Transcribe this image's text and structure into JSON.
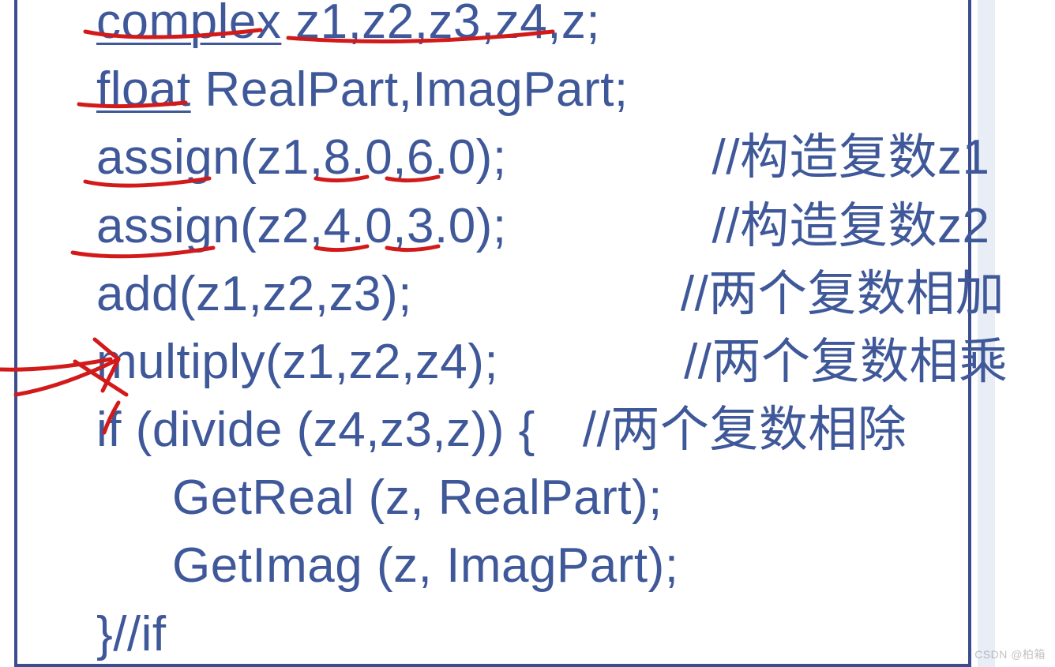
{
  "code": {
    "line1": {
      "kw": "complex",
      "rest": " z1,z2,z3,z4,z;"
    },
    "line2": {
      "kw": "float",
      "rest": " RealPart,ImagPart;"
    },
    "line3": {
      "text": "assign(z1,8.0,6.0);",
      "comment": "//构造复数z1"
    },
    "line4": {
      "text": "assign(z2,4.0,3.0);",
      "comment": "//构造复数z2"
    },
    "line5": {
      "text": "add(z1,z2,z3);",
      "comment": "//两个复数相加"
    },
    "line6": {
      "text": "multiply(z1,z2,z4);",
      "comment": "//两个复数相乘"
    },
    "line7": {
      "text": "if (divide (z4,z3,z))    {",
      "comment": "//两个复数相除"
    },
    "line8": {
      "text": "GetReal (z, RealPart);"
    },
    "line9": {
      "text": "GetImag (z, ImagPart);"
    },
    "line10": {
      "text": "}//if"
    }
  },
  "gaps": {
    "g3": "260px",
    "g4": "260px",
    "g5": "340px",
    "g6": "235px",
    "g7": "60px"
  },
  "watermark": "CSDN @柏箱"
}
